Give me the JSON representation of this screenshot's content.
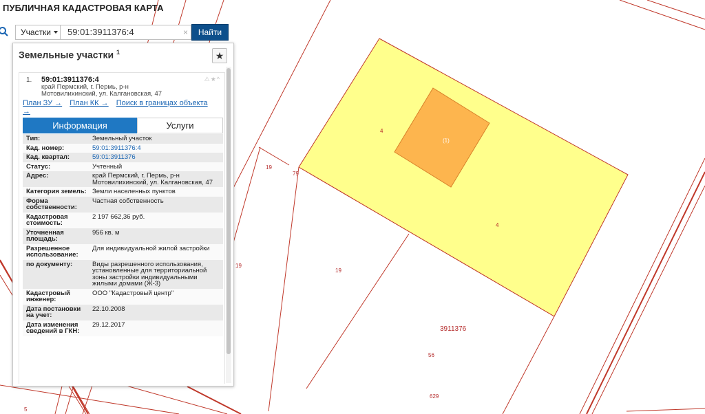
{
  "app": {
    "title": "ПУБЛИЧНАЯ КАДАСТРОВАЯ КАРТА"
  },
  "search": {
    "type_label": "Участки",
    "query": "59:01:3911376:4",
    "clear": "×",
    "button_label": "Найти"
  },
  "panel": {
    "title": "Земельные участки",
    "count": "1",
    "star": "★",
    "result": {
      "index": "1.",
      "number": "59:01:3911376:4",
      "address": "край Пермский, г. Пермь, р-н Мотовилихинский, ул. Калгановская, 47",
      "actions": "⚠★^",
      "links": [
        "План ЗУ →",
        "План КК →",
        "Поиск в границах объекта →"
      ]
    },
    "tabs": {
      "info": "Информация",
      "services": "Услуги"
    },
    "info": [
      {
        "label": "Тип:",
        "value": "Земельный участок"
      },
      {
        "label": "Кад. номер:",
        "value": "59:01:3911376:4",
        "link": true
      },
      {
        "label": "Кад. квартал:",
        "value": "59:01:3911376",
        "link": true
      },
      {
        "label": "Статус:",
        "value": "Учтенный"
      },
      {
        "label": "Адрес:",
        "value": "край Пермский, г. Пермь, р-н Мотовилихинский, ул. Калгановская, 47"
      },
      {
        "label": "Категория земель:",
        "value": "Земли населенных пунктов"
      },
      {
        "label": "Форма собственности:",
        "value": "Частная собственность"
      },
      {
        "label": "Кадастровая стоимость:",
        "value": "2 197 662,36 руб."
      },
      {
        "label": "Уточненная площадь:",
        "value": "956 кв. м"
      },
      {
        "label": "Разрешенное использование:",
        "value": "Для индивидуальной жилой застройки"
      },
      {
        "label": "по документу:",
        "value": "Виды разрешенного использования, установленные для территориальной зоны застройки индивидуальными жилыми домами (Ж-3)"
      },
      {
        "label": "Кадастровый инженер:",
        "value": "ООО \"Кадастровый центр\""
      },
      {
        "label": "Дата постановки на учет:",
        "value": "22.10.2008"
      },
      {
        "label": "Дата изменения сведений в ГКН:",
        "value": "29.12.2017"
      }
    ]
  },
  "map": {
    "colors": {
      "parcel": "#ffff8c",
      "building": "#fdb54e",
      "boundary": "#c0392b"
    },
    "labels": {
      "quarter": "3911376",
      "parcel_4a": "4",
      "parcel_4b": "4",
      "building": "(1)",
      "l19a": "19",
      "l19b": "19",
      "l19c": "19",
      "l79": "79",
      "l56": "56",
      "l629": "629",
      "l5": "5"
    }
  }
}
